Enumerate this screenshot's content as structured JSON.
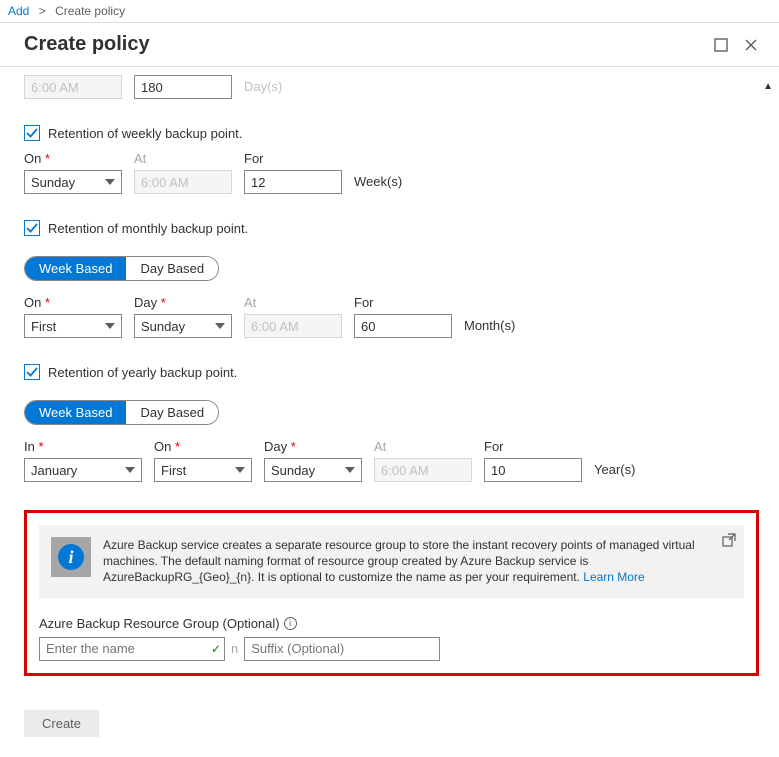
{
  "breadcrumb": {
    "add": "Add",
    "current": "Create policy"
  },
  "header": {
    "title": "Create policy"
  },
  "daily": {
    "time": "6:00 AM",
    "value": "180",
    "unit_fragment": "Day(s)"
  },
  "weekly": {
    "checkbox_label": "Retention of weekly backup point.",
    "on_label": "On",
    "on_value": "Sunday",
    "at_label": "At",
    "at_value": "6:00 AM",
    "for_label": "For",
    "for_value": "12",
    "unit": "Week(s)"
  },
  "monthly": {
    "checkbox_label": "Retention of monthly backup point.",
    "pill_week": "Week Based",
    "pill_day": "Day Based",
    "on_label": "On",
    "on_value": "First",
    "day_label": "Day",
    "day_value": "Sunday",
    "at_label": "At",
    "at_value": "6:00 AM",
    "for_label": "For",
    "for_value": "60",
    "unit": "Month(s)"
  },
  "yearly": {
    "checkbox_label": "Retention of yearly backup point.",
    "pill_week": "Week Based",
    "pill_day": "Day Based",
    "in_label": "In",
    "in_value": "January",
    "on_label": "On",
    "on_value": "First",
    "day_label": "Day",
    "day_value": "Sunday",
    "at_label": "At",
    "at_value": "6:00 AM",
    "for_label": "For",
    "for_value": "10",
    "unit": "Year(s)"
  },
  "info": {
    "text": "Azure Backup service creates a separate resource group to store the instant recovery points of managed virtual machines. The default naming format of resource group created by Azure Backup service is AzureBackupRG_{Geo}_{n}. It is optional to customize the name as per your requirement. ",
    "link": "Learn More"
  },
  "rg": {
    "label": "Azure Backup Resource Group (Optional)",
    "name_placeholder": "Enter the name",
    "separator": "n",
    "suffix_placeholder": "Suffix (Optional)"
  },
  "footer": {
    "create": "Create"
  }
}
